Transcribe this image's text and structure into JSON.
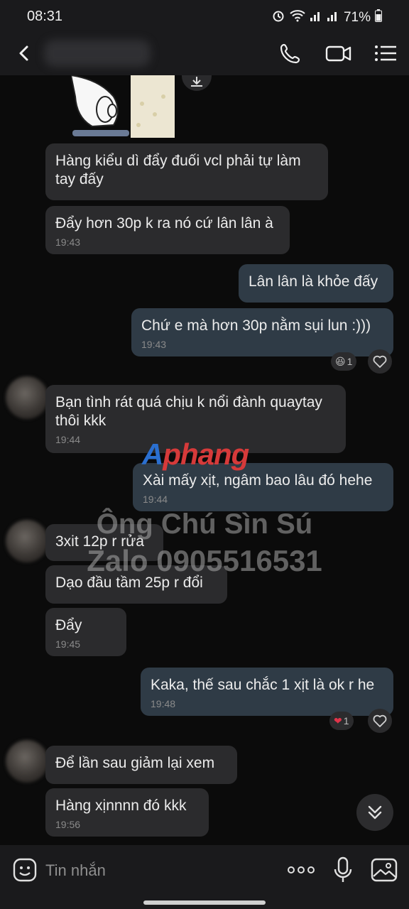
{
  "status_bar": {
    "time": "08:31",
    "battery": "71%"
  },
  "header": {
    "contact_name": ""
  },
  "messages": [
    {
      "dir": "in",
      "text": "Hàng kiểu dì đẩy đuối vcl phải tự làm tay đấy",
      "time": ""
    },
    {
      "dir": "in",
      "text": "Đẩy hơn 30p k ra nó cứ lân lân à",
      "time": "19:43"
    },
    {
      "dir": "out",
      "text": "Lân lân là khỏe đấy",
      "time": ""
    },
    {
      "dir": "out",
      "text": "Chứ e  mà hơn 30p nằm sụi lun :)))",
      "time": "19:43",
      "reaction_count": "1"
    },
    {
      "dir": "in",
      "text": "Bạn tình rát quá chịu k nổi đành quaytay thôi kkk",
      "time": "19:44"
    },
    {
      "dir": "out",
      "text": "Xài mấy xịt, ngâm bao lâu đó hehe",
      "time": "19:44"
    },
    {
      "dir": "in",
      "text": "3xit 12p r rửa",
      "time": ""
    },
    {
      "dir": "in",
      "text": "Dạo đầu tầm 25p r đổi",
      "time": ""
    },
    {
      "dir": "in",
      "text": "Đẩy",
      "time": "19:45"
    },
    {
      "dir": "out",
      "text": "Kaka, thế sau chắc 1 xịt là ok r he",
      "time": "19:48",
      "reaction_count": "1"
    },
    {
      "dir": "in",
      "text": "Để lần sau giảm lại xem",
      "time": ""
    },
    {
      "dir": "in",
      "text": "Hàng xịnnnn đó kkk",
      "time": "19:56"
    }
  ],
  "watermark": {
    "brand_a": "A",
    "brand_rest": "phang",
    "line1": "Ông Chú Sìn Sú",
    "line2": "Zalo 0905516531"
  },
  "input": {
    "placeholder": "Tin nhắn"
  },
  "colors": {
    "background": "#0b0b0b",
    "incoming_bubble": "#2b2b2d",
    "outgoing_bubble": "#2f3b46",
    "bar": "#1a1a1c"
  }
}
